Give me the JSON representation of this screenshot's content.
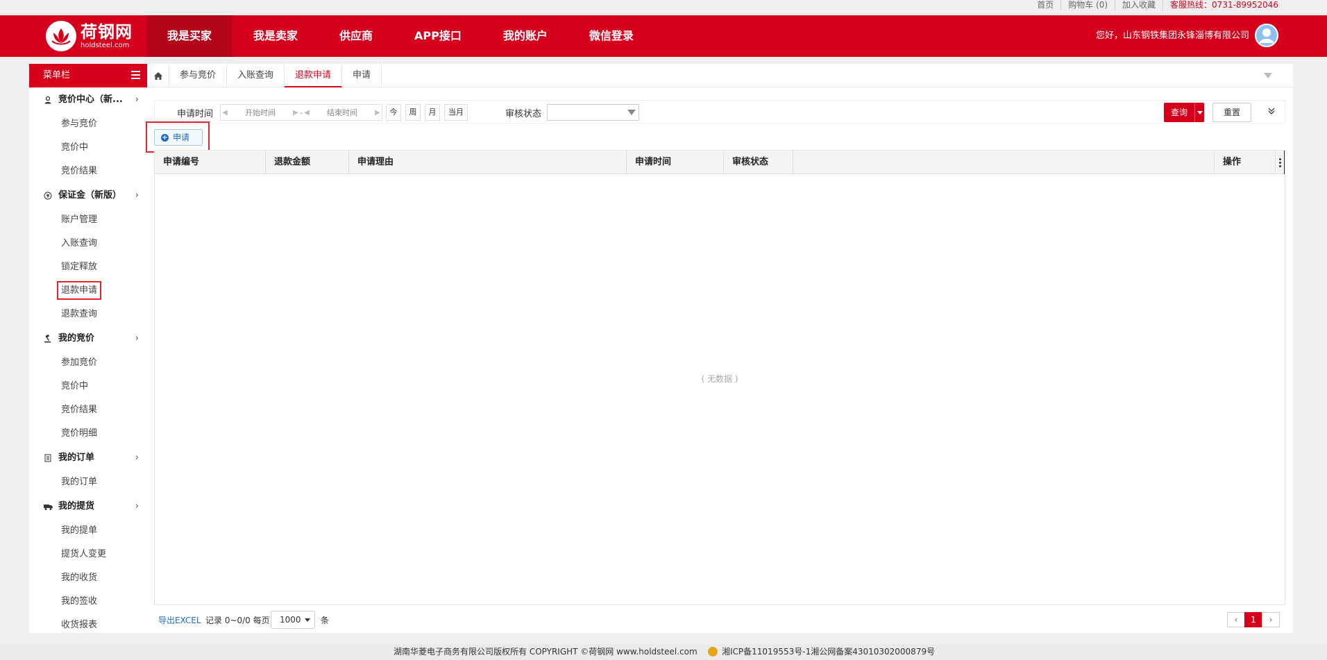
{
  "topbar": {
    "links": [
      "首页",
      "购物车 (0)",
      "加入收藏",
      "客服热线：0731-89952046"
    ]
  },
  "header": {
    "logo_cn": "荷钢网",
    "logo_en": "holdsteel.com",
    "nav": [
      "我是买家",
      "我是卖家",
      "供应商",
      "APP接口",
      "我的账户",
      "微信登录"
    ],
    "active_nav": "我是买家",
    "greeting": "您好，山东钢铁集团永锋淄博有限公司",
    "brand_color": "#d6001c"
  },
  "sidebar": {
    "title": "菜单栏",
    "groups": [
      {
        "label": "竞价中心（新...",
        "icon": "user-icon",
        "items": [
          "参与竞价",
          "竞价中",
          "竞价结果"
        ]
      },
      {
        "label": "保证金（新版）",
        "icon": "deposit-icon",
        "items": [
          "账户管理",
          "入账查询",
          "锁定释放",
          "退款申请",
          "退款查询"
        ]
      },
      {
        "label": "我的竞价",
        "icon": "auction-icon",
        "items": [
          "参加竞价",
          "竞价中",
          "竞价结果",
          "竞价明细"
        ]
      },
      {
        "label": "我的订单",
        "icon": "document-icon",
        "items": [
          "我的订单"
        ]
      },
      {
        "label": "我的提货",
        "icon": "truck-icon",
        "items": [
          "我的提单",
          "提货人变更",
          "我的收货",
          "我的签收",
          "收货报表"
        ]
      }
    ],
    "highlighted_item": "退款申请"
  },
  "tabs": {
    "items": [
      "参与竞价",
      "入账查询",
      "退款申请",
      "申请"
    ],
    "active": "退款申请"
  },
  "filter": {
    "apply_time_label": "申请时间",
    "start_placeholder": "开始时间",
    "separator": "-",
    "end_placeholder": "结束时间",
    "quick": [
      "今",
      "周",
      "月",
      "当月"
    ],
    "status_label": "审核状态",
    "status_value": "",
    "query": "查询",
    "reset": "重置"
  },
  "toolbar": {
    "apply_label": "申请"
  },
  "grid": {
    "columns": [
      "申请编号",
      "退款金额",
      "申请理由",
      "申请时间",
      "审核状态",
      "操作"
    ],
    "rows": [],
    "empty_text": "( 无数据 )"
  },
  "pager": {
    "export": "导出EXCEL",
    "record_text": "记录 0~0/0 每页",
    "page_size": "1000",
    "unit": "条",
    "current_page": "1"
  },
  "footer": {
    "copyright": "湖南华菱电子商务有限公司版权所有 COPYRIGHT ©荷钢网 www.holdsteel.com",
    "icp": "湘ICP备11019553号-1湘公网备案43010302000879号"
  }
}
